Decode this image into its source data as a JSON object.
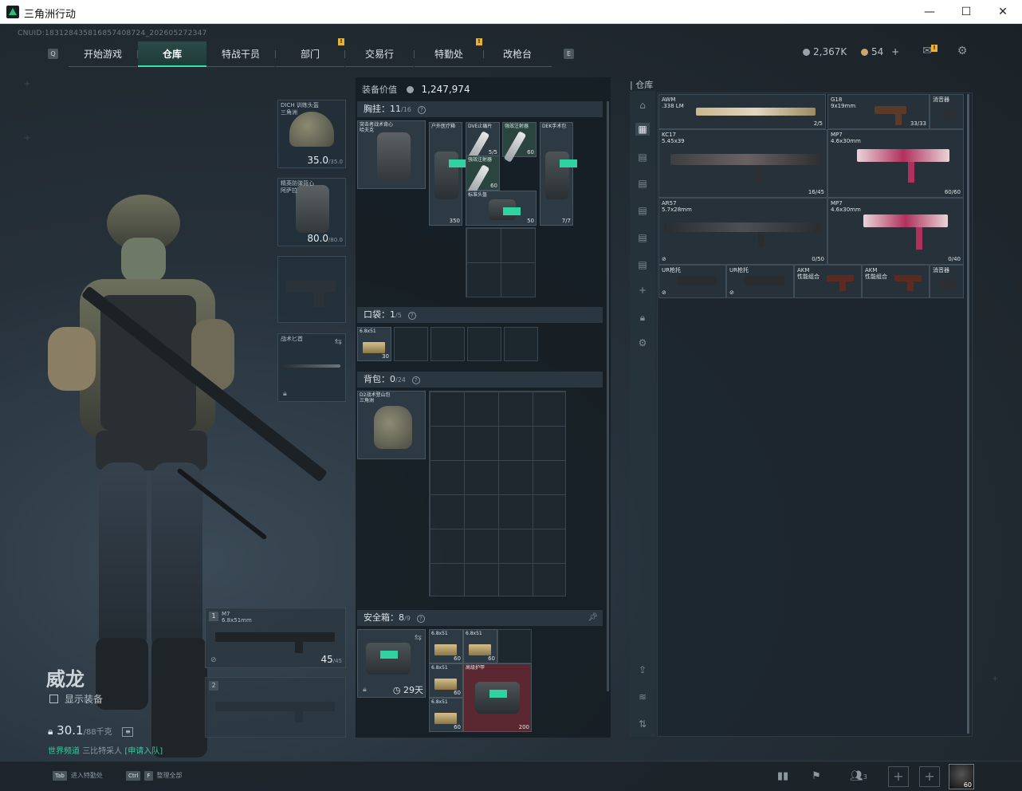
{
  "window": {
    "title": "三角洲行动",
    "minimize": "—",
    "maximize": "☐",
    "close": "✕"
  },
  "uid": "CNUID:1831284358168574087​24_202605272347",
  "nav": {
    "left_key": "Q",
    "right_key": "E",
    "tabs": [
      "开始游戏",
      "仓库",
      "特战干员",
      "部门",
      "交易行",
      "特勤处",
      "改枪台"
    ],
    "active_index": 1,
    "badge": "!"
  },
  "currency": {
    "hafu_coin": "2,367K",
    "tickets": "54",
    "tickets_plus": "+"
  },
  "character": {
    "name": "威龙",
    "show_equipment": "显示装备",
    "weight": "30.1",
    "weight_max": "/88千克",
    "squad_prefix": "世界频道",
    "squad_name": "三比特采人",
    "squad_action": "[申请入队]"
  },
  "gear": {
    "helmet": {
      "name": "DICH 训练头盔",
      "sub": "三角洲",
      "dur": "35.0",
      "dur_max": "/35.0"
    },
    "armor": {
      "name": "精英防弹背心",
      "sub": "阿萨拉",
      "dur": "80.0",
      "dur_max": "/80.0"
    },
    "knife": {
      "name": "战术匕首"
    },
    "primary": {
      "idx": "1",
      "name": "M7",
      "caliber": "6.8x51mm",
      "ammo": "45",
      "ammo_max": "/45"
    },
    "secondary": {
      "idx": "2"
    }
  },
  "loadout": {
    "value_label": "装备价值",
    "value": "1,247,974",
    "chest": {
      "label": "胸挂：",
      "count": "11",
      "max": "/16"
    },
    "chest_rig": {
      "name": "突击者战术背心",
      "sub": "哈夫克"
    },
    "chest_items": [
      {
        "name": "户外医疗箱",
        "qty": "350"
      },
      {
        "name": "DVE止痛片",
        "qty": "5/5"
      },
      {
        "name": "强效注射器",
        "qty": "60"
      },
      {
        "name": "DEK手术包",
        "qty": "7/7"
      },
      {
        "name": "强效注射器",
        "qty": "60"
      },
      {
        "name": "标准头盔",
        "qty": "50"
      }
    ],
    "pocket": {
      "label": "口袋：",
      "count": "1",
      "max": "/5"
    },
    "pocket_items": [
      {
        "name": "6.8x51",
        "qty": "30"
      }
    ],
    "backpack": {
      "label": "背包：",
      "count": "0",
      "max": "/24"
    },
    "backpack_item": {
      "name": "D2战术登山包",
      "sub": "三角洲"
    },
    "safebox": {
      "label": "安全箱：",
      "count": "8",
      "max": "/9",
      "timer": "29天"
    },
    "safe_items": [
      {
        "name": "6.8x51",
        "qty": "60"
      },
      {
        "name": "6.8x51",
        "qty": "60"
      },
      {
        "name": "6.8x51",
        "qty": "60"
      },
      {
        "name": "6.8x51",
        "qty": "60"
      },
      {
        "name": "高级护甲",
        "qty": "200"
      }
    ]
  },
  "warehouse": {
    "title": "仓库",
    "guns": [
      {
        "name": "AWM",
        "sub": ".338 LM",
        "qty": "2/5"
      },
      {
        "name": "G18",
        "sub": "9x19mm",
        "qty": "33/33"
      },
      {
        "name": "消音器",
        "sub": "",
        "qty": ""
      },
      {
        "name": "KC17",
        "sub": "5.45x39",
        "qty": "16/45"
      },
      {
        "name": "MP7",
        "sub": "4.6x30mm",
        "qty": "60/60"
      },
      {
        "name": "AR57",
        "sub": "5.7x28mm",
        "qty": "0/50"
      },
      {
        "name": "MP7",
        "sub": "4.6x30mm",
        "qty": "0/40"
      },
      {
        "name": "UR枪托",
        "sub": "",
        "qty": ""
      },
      {
        "name": "UR枪托",
        "sub": "",
        "qty": ""
      },
      {
        "name": "AKM",
        "sub": "性能组合",
        "qty": ""
      },
      {
        "name": "AKM",
        "sub": "性能组合",
        "qty": ""
      },
      {
        "name": "消音器",
        "sub": "",
        "qty": ""
      }
    ]
  },
  "bottom": {
    "hint1_key": "Tab",
    "hint1_text": "进入特勤处",
    "hint2_key1": "Ctrl",
    "hint2_key2": "F",
    "hint2_text": "整理全部",
    "squad_count": "3",
    "level": "60"
  },
  "colors": {
    "accent": "#37e0a8",
    "warn": "#e8b23a",
    "rare_red": "#5b2730",
    "green_item": "#29453e"
  }
}
